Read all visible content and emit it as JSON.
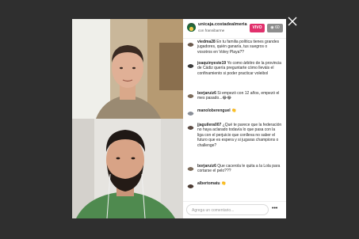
{
  "header": {
    "account": "unicaja.costadealmeria",
    "subtitle": "con frannibarme",
    "live_label": "VIVO",
    "viewers": "60"
  },
  "comments": [
    {
      "user": "viedma28",
      "text": "En tu familia política tienes grandes jugadores, quién ganaría, tus suegros o vosotros en Voley Playa??"
    },
    {
      "user": "joaquinyeste19",
      "text": "Yo como árbitro de la provincia de Cádiz quería preguntarte cómo lleváis el confinamiento si poder practicar voleibol"
    },
    {
      "user": "borjaruiz6",
      "text": "Si empezó con 12 años, empezó el mes pasado...😂😂"
    },
    {
      "user": "manoloberenguel",
      "text": "👏"
    },
    {
      "user": "jjaguilera007",
      "text": "¿Qué te parece que la federación no haya aclarado todavía lo que pasa con la liga con el perjuicio que conlleva no saber el futuro que es espera y si jugaras champions o challenge?"
    },
    {
      "user": "borjaruiz6",
      "text": "Que cacerola le quita a la Lola para cortarse el pelo???"
    },
    {
      "user": "albertomatu",
      "text": "👏"
    }
  ],
  "footer": {
    "placeholder": "Agrega un comentario...",
    "more": "•••"
  },
  "close_icon": "close-icon",
  "colors": {
    "live": "#e1306c",
    "backdrop": "#2f2f2f"
  }
}
